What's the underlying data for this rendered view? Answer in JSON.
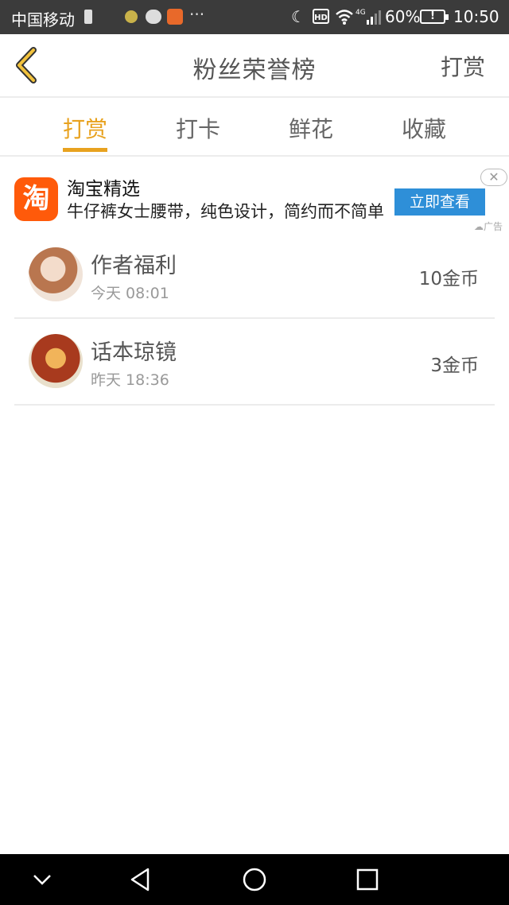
{
  "status_bar": {
    "carrier": "中国移动",
    "network": "4G",
    "battery": "60%",
    "time": "10:50"
  },
  "header": {
    "title": "粉丝荣誉榜",
    "action_label": "打赏"
  },
  "tabs": [
    {
      "label": "打赏",
      "active": true
    },
    {
      "label": "打卡",
      "active": false
    },
    {
      "label": "鲜花",
      "active": false
    },
    {
      "label": "收藏",
      "active": false
    }
  ],
  "ad": {
    "logo_text": "淘",
    "title": "淘宝精选",
    "description": "牛仔裤女士腰带，纯色设计，简约而不简单",
    "cta_label": "立即查看",
    "tag": "广告"
  },
  "rewards": [
    {
      "name": "作者福利",
      "time": "今天 08:01",
      "amount": "10金币"
    },
    {
      "name": "话本琼镜",
      "time": "昨天 18:36",
      "amount": "3金币"
    }
  ],
  "colors": {
    "accent": "#e8a21f",
    "status_bar": "#3b3b3b",
    "ad_button": "#2e8fd8",
    "taobao": "#ff5a0a"
  }
}
